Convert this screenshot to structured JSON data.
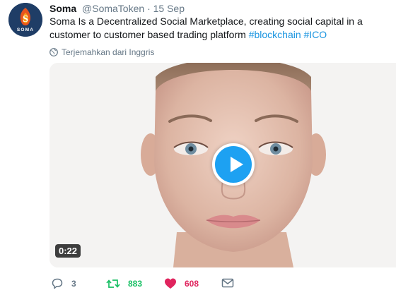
{
  "tweet": {
    "author_name": "Soma",
    "author_handle": "@SomaToken",
    "separator": "·",
    "date": "15 Sep",
    "text_main": "Soma Is a Decentralized Social Marketplace, creating social capital in a customer to customer based trading platform ",
    "hashtags": [
      "#blockchain",
      "#ICO"
    ],
    "translate_label": "Terjemahkan dari Inggris",
    "avatar_text": "SOMA"
  },
  "video": {
    "duration": "0:22"
  },
  "actions": {
    "reply_count": "3",
    "retweet_count": "883",
    "like_count": "608"
  },
  "colors": {
    "link": "#1b95e0",
    "retweet": "#17bf63",
    "like": "#e0245e",
    "play": "#1da1f2"
  },
  "icons": {
    "reply": "reply-icon",
    "retweet": "retweet-icon",
    "like": "heart-icon",
    "dm": "envelope-icon",
    "globe": "globe-icon",
    "play": "play-icon"
  }
}
